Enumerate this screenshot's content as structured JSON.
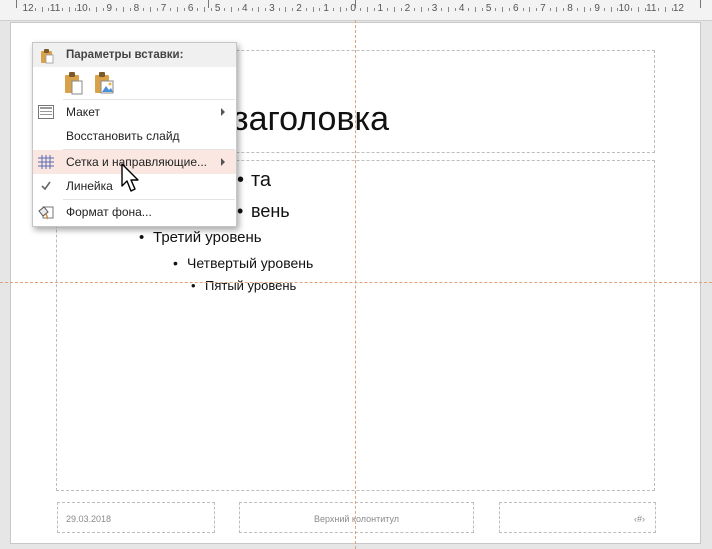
{
  "ruler": {
    "numbers": [
      "12",
      "11",
      "10",
      "9",
      "8",
      "7",
      "6",
      "5",
      "4",
      "3",
      "2",
      "1",
      "0",
      "1",
      "2",
      "3",
      "4",
      "5",
      "6",
      "7",
      "8",
      "9",
      "10",
      "11",
      "12"
    ]
  },
  "slide": {
    "title": "заголовка",
    "bullets": {
      "level1": "та",
      "level2": "вень",
      "level3": "Третий уровень",
      "level4": "Четвертый уровень",
      "level5": "Пятый уровень"
    },
    "footer": {
      "date": "29.03.2018",
      "center": "Верхний колонтитул",
      "number": "‹#›"
    }
  },
  "menu": {
    "paste_header": "Параметры вставки:",
    "items": [
      {
        "label": "Макет",
        "icon": "layout-icon",
        "submenu": true
      },
      {
        "label": "Восстановить слайд",
        "icon": "",
        "submenu": false
      },
      {
        "label": "Сетка и направляющие...",
        "icon": "grid-icon",
        "submenu": true
      },
      {
        "label": "Линейка",
        "icon": "checkmark-icon",
        "submenu": false
      },
      {
        "label": "Формат фона...",
        "icon": "format-background-icon",
        "submenu": false
      }
    ]
  },
  "colors": {
    "guide": "#e0a27a",
    "highlight": "#fbe7e1",
    "clipboard": "#d9a24a"
  }
}
